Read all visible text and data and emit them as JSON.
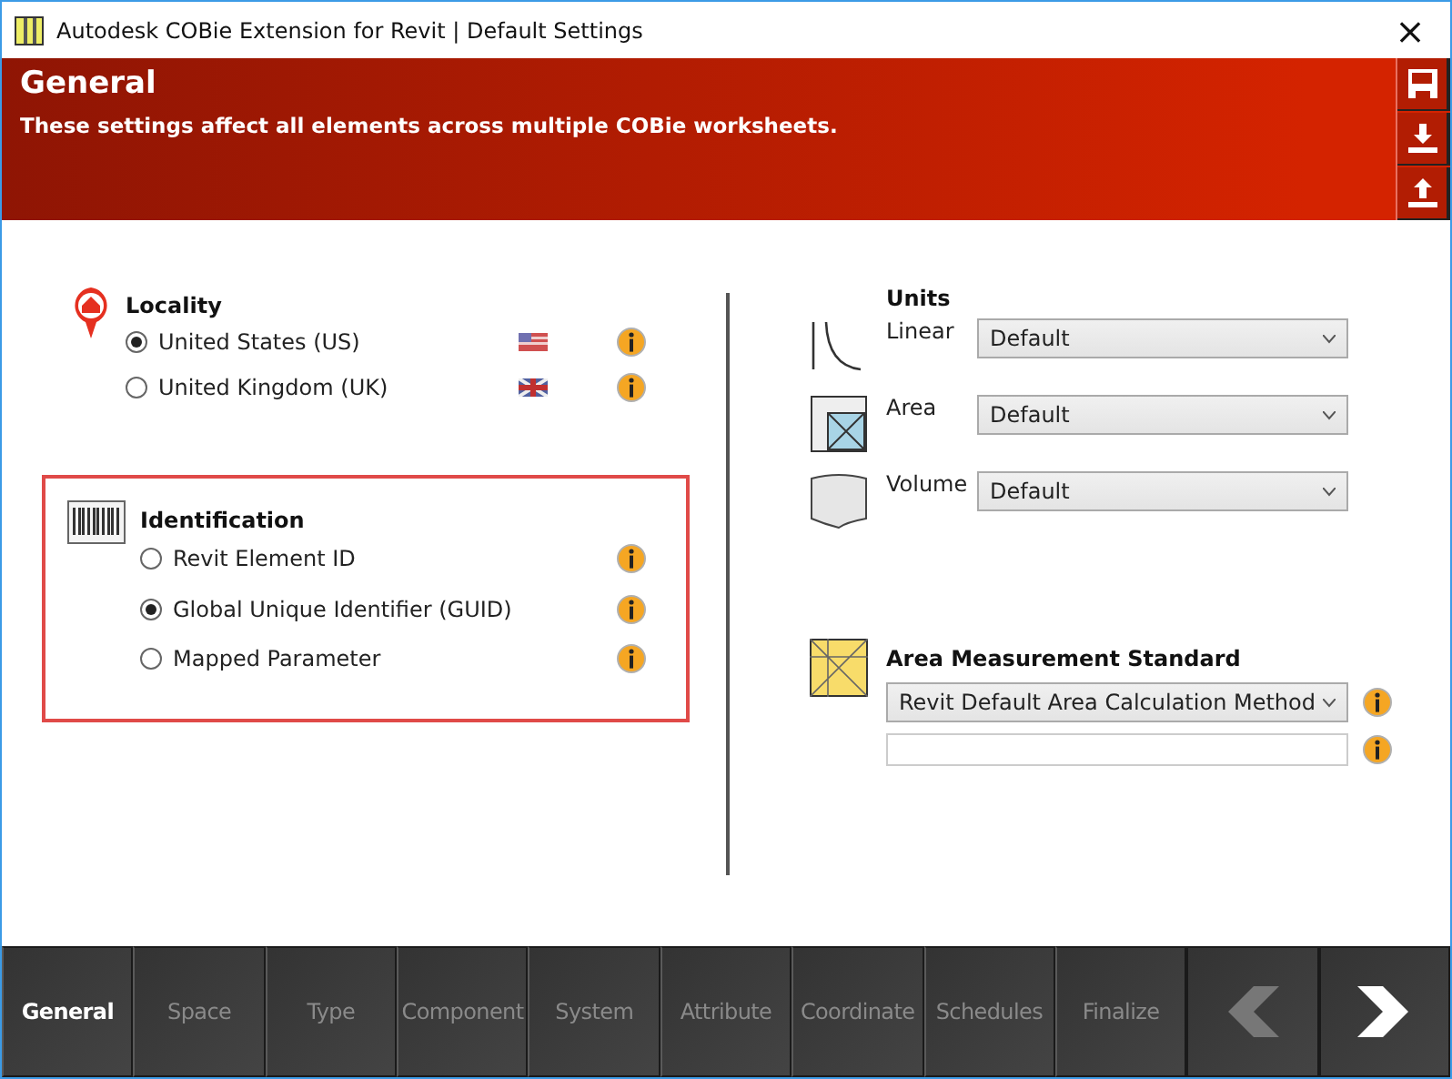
{
  "window": {
    "title": "Autodesk COBie Extension for Revit | Default Settings",
    "close": "×"
  },
  "header": {
    "title": "General",
    "subtitle": "These settings affect all elements across multiple COBie worksheets."
  },
  "locality": {
    "title": "Locality",
    "options": [
      {
        "label": "United States (US)",
        "selected": true,
        "kind": "us"
      },
      {
        "label": "United Kingdom (UK)",
        "selected": false,
        "kind": "uk"
      }
    ]
  },
  "identification": {
    "title": "Identification",
    "highlighted": true,
    "options": [
      {
        "label": "Revit Element ID",
        "selected": false
      },
      {
        "label": "Global Unique Identifier (GUID)",
        "selected": true
      },
      {
        "label": "Mapped Parameter",
        "selected": false
      }
    ]
  },
  "units": {
    "title": "Units",
    "rows": [
      {
        "kind": "linear",
        "label": "Linear",
        "value": "Default"
      },
      {
        "kind": "area",
        "label": "Area",
        "value": "Default"
      },
      {
        "kind": "volume",
        "label": "Volume",
        "value": "Default"
      }
    ]
  },
  "area_measurement": {
    "title": "Area Measurement Standard",
    "value": "Revit Default Area Calculation Method"
  },
  "nav": {
    "tabs": [
      {
        "label": "General",
        "selected": true
      },
      {
        "label": "Space",
        "selected": false
      },
      {
        "label": "Type",
        "selected": false
      },
      {
        "label": "Component",
        "selected": false
      },
      {
        "label": "System",
        "selected": false
      },
      {
        "label": "Attribute",
        "selected": false
      },
      {
        "label": "Coordinate",
        "selected": false
      },
      {
        "label": "Schedules",
        "selected": false
      },
      {
        "label": "Finalize",
        "selected": false
      }
    ],
    "previous": {
      "disabled": true
    },
    "next": {
      "disabled": false
    }
  }
}
